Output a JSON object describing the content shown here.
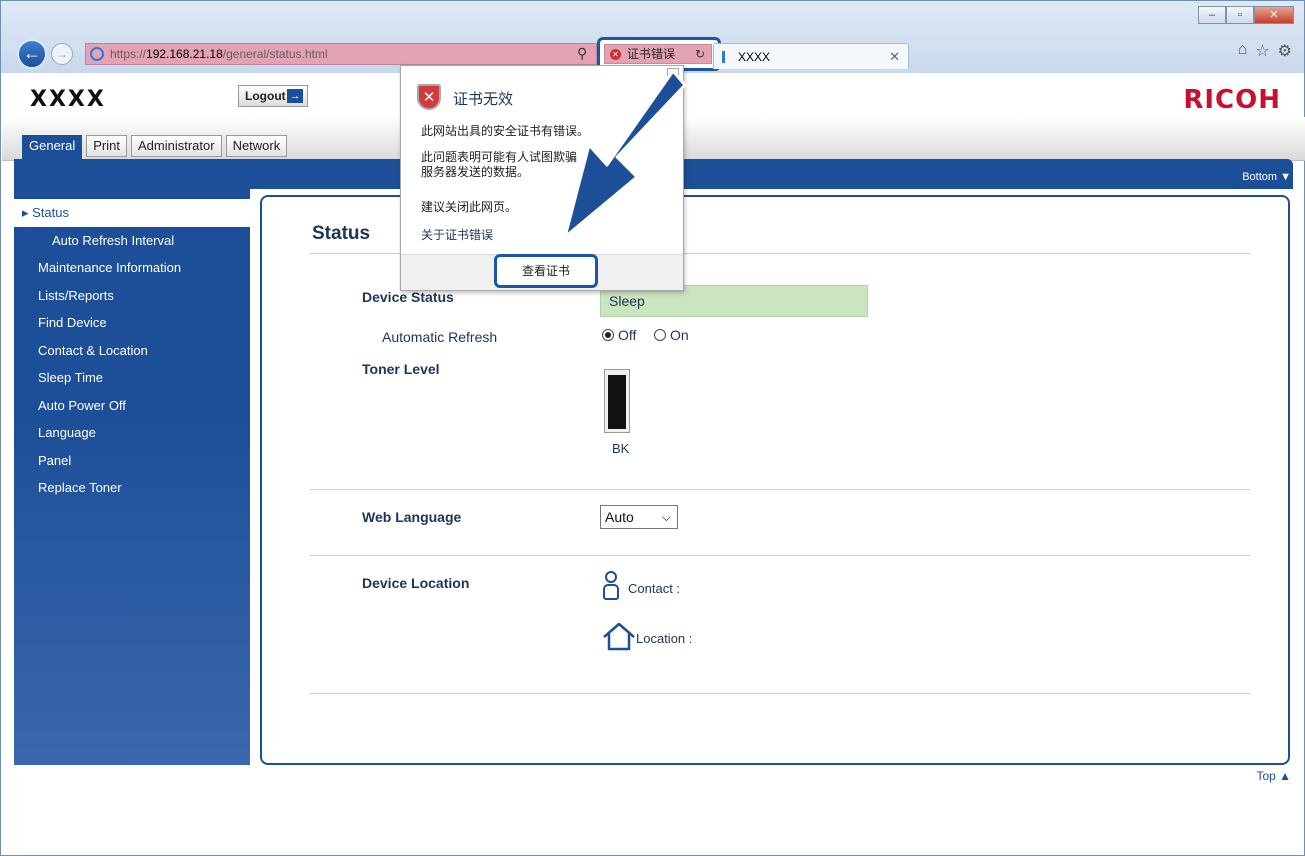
{
  "browser": {
    "window_controls": {
      "minimize": "–",
      "maximize": "▫",
      "close": "✕"
    },
    "address": {
      "scheme": "https://",
      "host": "192.168.21.18",
      "path": "/general/status.html"
    },
    "cert_error_label": "证书错误",
    "tab_title": "XXXX",
    "icons": [
      "home-icon",
      "star-icon",
      "gear-icon"
    ]
  },
  "header": {
    "logo": "XXXX",
    "logout_label": "Logout",
    "brand": "RICOH"
  },
  "tabs": [
    {
      "label": "General",
      "active": true
    },
    {
      "label": "Print",
      "active": false
    },
    {
      "label": "Administrator",
      "active": false
    },
    {
      "label": "Network",
      "active": false
    }
  ],
  "bottom_link": "Bottom ▼",
  "top_link": "Top ▲",
  "sidebar": {
    "items": [
      {
        "label": "▸ Status",
        "active": true
      },
      {
        "label": "Auto Refresh Interval",
        "sub": true
      },
      {
        "label": "Maintenance Information"
      },
      {
        "label": "Lists/Reports"
      },
      {
        "label": "Find Device"
      },
      {
        "label": "Contact & Location"
      },
      {
        "label": "Sleep Time"
      },
      {
        "label": "Auto Power Off"
      },
      {
        "label": "Language"
      },
      {
        "label": "Panel"
      },
      {
        "label": "Replace Toner"
      }
    ]
  },
  "content": {
    "title": "Status",
    "device_status_label": "Device Status",
    "device_status_value": "Sleep",
    "auto_refresh_label": "Automatic Refresh",
    "radio_off": "Off",
    "radio_on": "On",
    "toner_label": "Toner Level",
    "toner_color": "BK",
    "toner_fraction": 0.93,
    "web_language_label": "Web Language",
    "web_language_value": "Auto",
    "device_location_label": "Device Location",
    "contact_label": "Contact :",
    "location_label": "Location :"
  },
  "popup": {
    "title": "证书无效",
    "line1": "此网站出具的安全证书有错误。",
    "line2a": "此问题表明可能有人试图欺骗",
    "line2b": "服务器发送的数据。",
    "line3": "建议关闭此网页。",
    "link": "关于证书错误",
    "view_cert_button": "查看证书"
  },
  "colors": {
    "primary_blue": "#1d4f98",
    "brand_red": "#c8102e",
    "status_green": "#cbe5c0",
    "error_pink": "#e3a3b4"
  }
}
